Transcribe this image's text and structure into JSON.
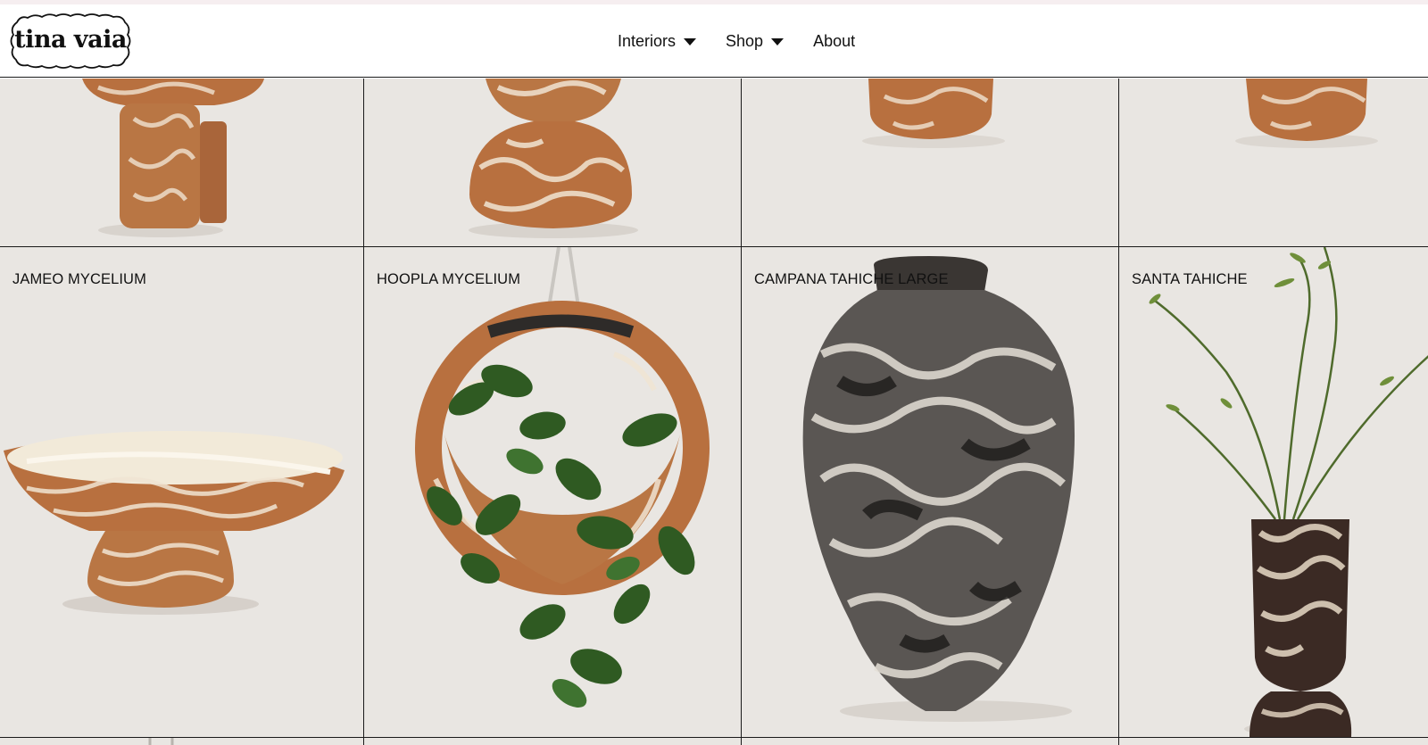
{
  "brand": {
    "logo_text": "tina vaia"
  },
  "nav": {
    "items": [
      {
        "label": "Interiors",
        "has_dropdown": true
      },
      {
        "label": "Shop",
        "has_dropdown": true
      },
      {
        "label": "About",
        "has_dropdown": false
      }
    ]
  },
  "products": [
    {
      "title": "JAMEO MYCELIUM"
    },
    {
      "title": "HOOPLA MYCELIUM"
    },
    {
      "title": "CAMPANA TAHICHE LARGE"
    },
    {
      "title": "SANTA TAHICHE"
    }
  ],
  "colors": {
    "background": "#e9e6e2",
    "terracotta": "#b8703f",
    "cream": "#f0e4d2",
    "dark_marble": "#2e2b29",
    "leaf": "#2f5a22",
    "grid_line": "#1a1a1a"
  }
}
